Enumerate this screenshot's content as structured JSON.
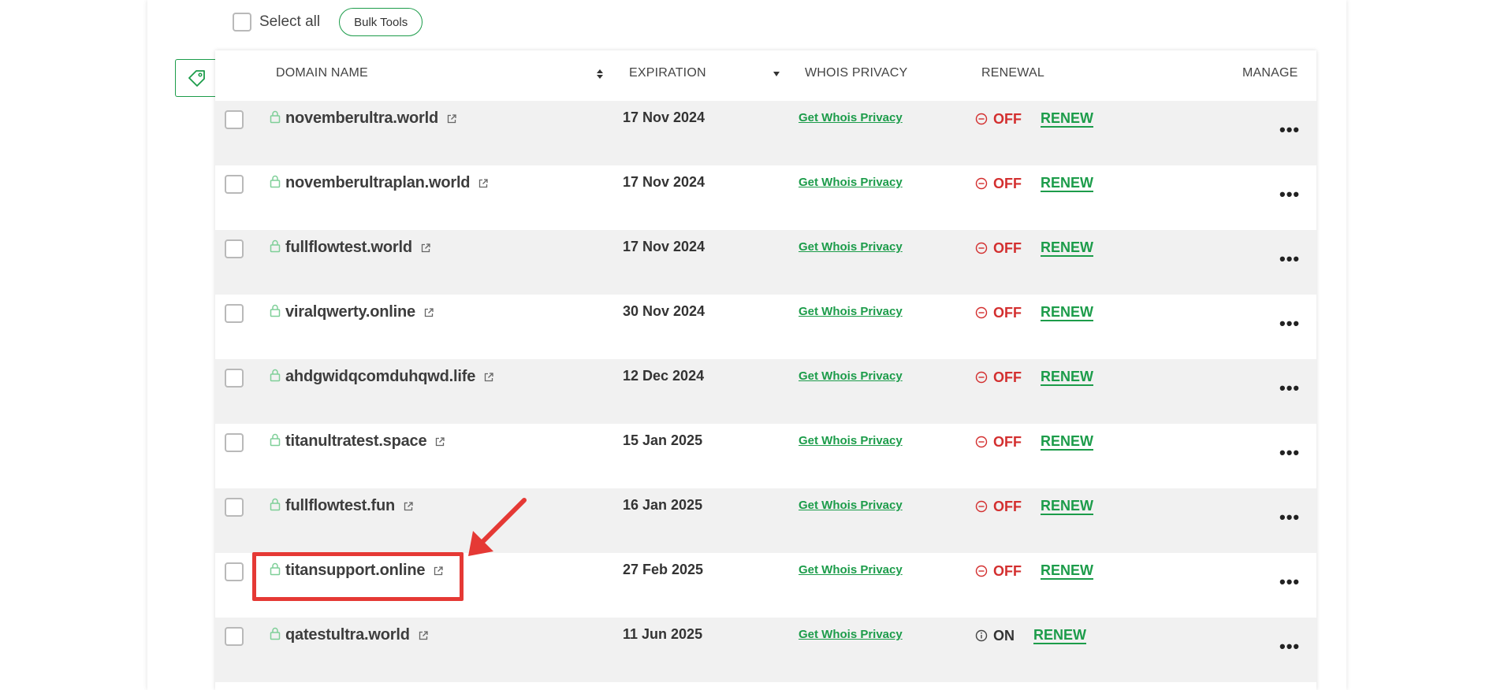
{
  "toolbar": {
    "select_all_label": "Select all",
    "bulk_tools_label": "Bulk Tools"
  },
  "table": {
    "headers": {
      "domain_name": "DOMAIN NAME",
      "expiration": "EXPIRATION",
      "whois_privacy": "WHOIS PRIVACY",
      "renewal": "RENEWAL",
      "manage": "MANAGE"
    },
    "renew_label": "RENEW",
    "whois_label": "Get Whois Privacy",
    "more_label": "•••",
    "rows": [
      {
        "domain": "novemberultra.world",
        "expiration": "17 Nov 2024",
        "status": "OFF"
      },
      {
        "domain": "novemberultraplan.world",
        "expiration": "17 Nov 2024",
        "status": "OFF"
      },
      {
        "domain": "fullflowtest.world",
        "expiration": "17 Nov 2024",
        "status": "OFF"
      },
      {
        "domain": "viralqwerty.online",
        "expiration": "30 Nov 2024",
        "status": "OFF"
      },
      {
        "domain": "ahdgwidqcomduhqwd.life",
        "expiration": "12 Dec 2024",
        "status": "OFF"
      },
      {
        "domain": "titanultratest.space",
        "expiration": "15 Jan 2025",
        "status": "OFF"
      },
      {
        "domain": "fullflowtest.fun",
        "expiration": "16 Jan 2025",
        "status": "OFF"
      },
      {
        "domain": "titansupport.online",
        "expiration": "27 Feb 2025",
        "status": "OFF"
      },
      {
        "domain": "qatestultra.world",
        "expiration": "11 Jun 2025",
        "status": "ON"
      }
    ]
  },
  "colors": {
    "brand_green": "#1c9c4a",
    "off_red": "#d32f2f",
    "annotation_red": "#e53935"
  }
}
